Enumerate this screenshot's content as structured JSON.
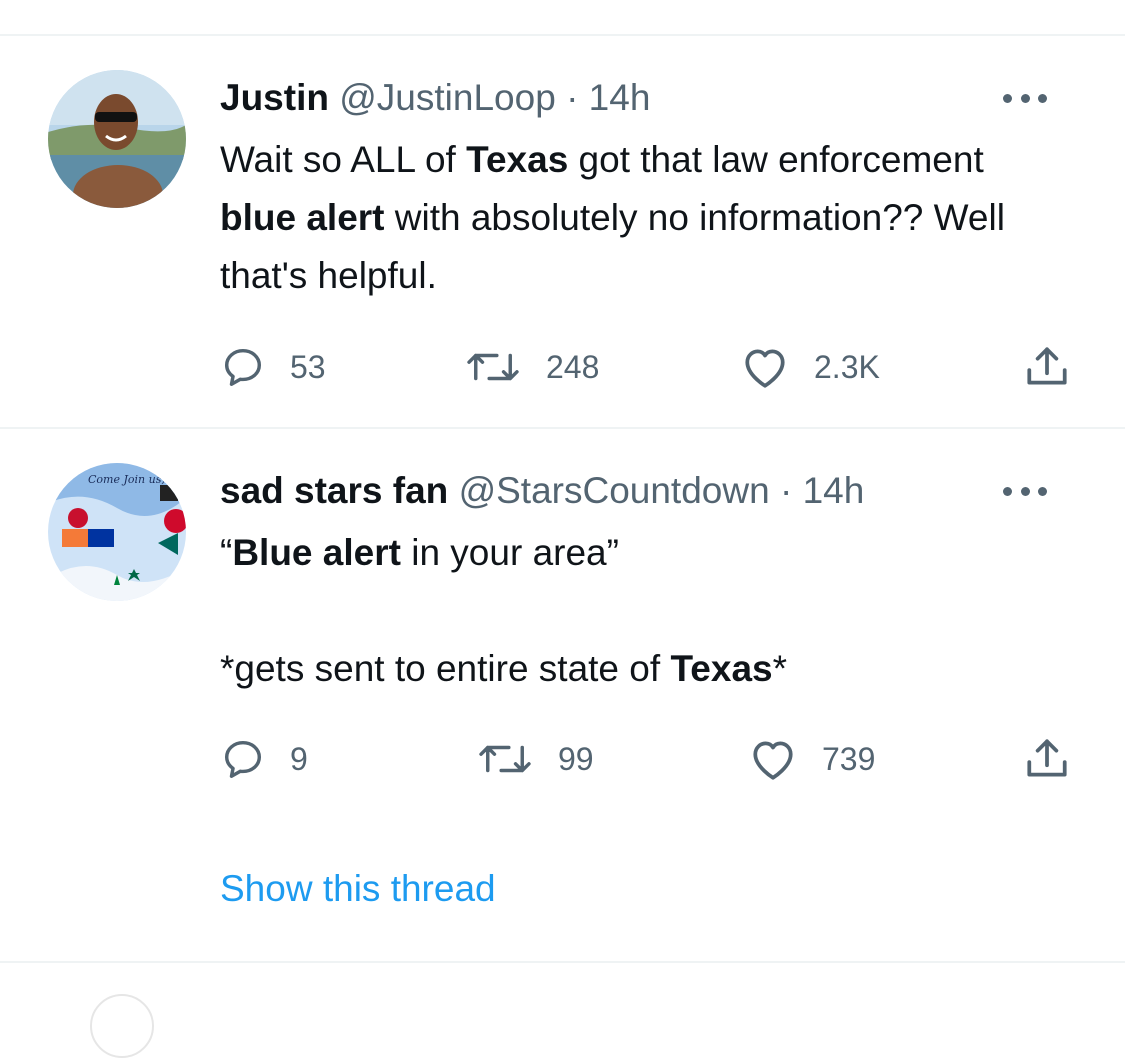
{
  "tweets": [
    {
      "name": "Justin",
      "handle": "@JustinLoop",
      "separator": "·",
      "time": "14h",
      "text_parts": [
        {
          "t": "Wait so ALL of ",
          "b": false
        },
        {
          "t": "Texas",
          "b": true
        },
        {
          "t": " got that law enforcement ",
          "b": false
        },
        {
          "t": "blue alert",
          "b": true
        },
        {
          "t": " with absolutely no information?? Well that's helpful.",
          "b": false
        }
      ],
      "counts": {
        "replies": "53",
        "retweets": "248",
        "likes": "2.3K"
      }
    },
    {
      "name": "sad stars fan",
      "handle": "@StarsCountdown",
      "separator": "·",
      "time": "14h",
      "text_line1_parts": [
        {
          "t": "“",
          "b": false
        },
        {
          "t": "Blue alert",
          "b": true
        },
        {
          "t": " in your area”",
          "b": false
        }
      ],
      "text_line2_parts": [
        {
          "t": "*gets sent to entire state of ",
          "b": false
        },
        {
          "t": "Texas",
          "b": true
        },
        {
          "t": "*",
          "b": false
        }
      ],
      "counts": {
        "replies": "9",
        "retweets": "99",
        "likes": "739"
      },
      "avatar_text": "Come Join us, Dallas!"
    }
  ],
  "show_thread_label": "Show this thread",
  "icons": {
    "reply": "reply-icon",
    "retweet": "retweet-icon",
    "like": "heart-icon",
    "share": "share-icon",
    "more": "more-icon"
  },
  "colors": {
    "text": "#0f1419",
    "secondary": "#536471",
    "link": "#1d9bf0",
    "divider": "#eff3f4"
  }
}
